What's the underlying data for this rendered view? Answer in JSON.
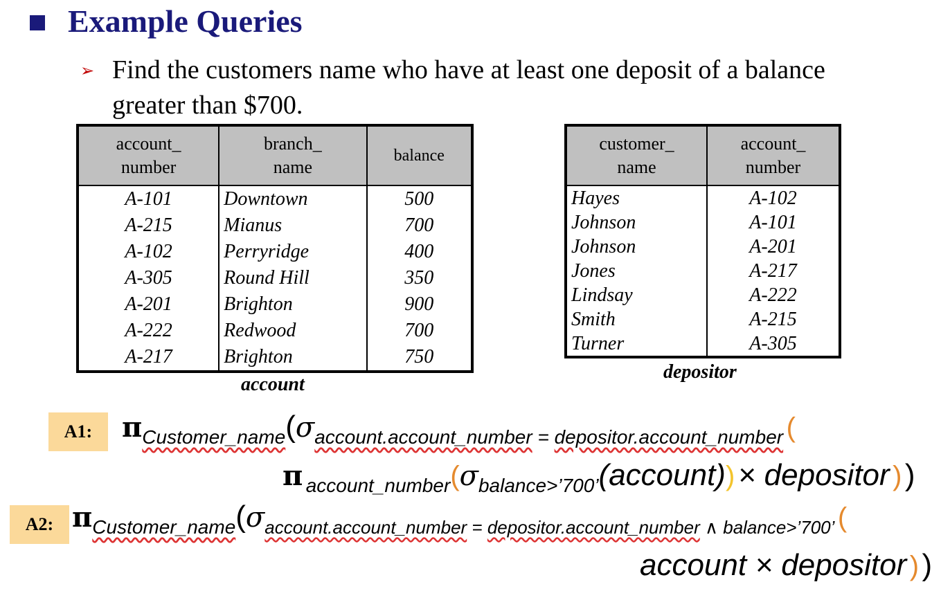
{
  "heading": "Example Queries",
  "task_line1": "Find the customers name who have at least one deposit of a balance",
  "task_line2": "greater than  $700.",
  "account": {
    "caption": "account",
    "headers": [
      [
        "account_",
        "number"
      ],
      [
        "branch_",
        "name"
      ],
      [
        "balance",
        ""
      ]
    ],
    "rows": [
      [
        "A-101",
        "Downtown",
        "500"
      ],
      [
        "A-215",
        "Mianus",
        "700"
      ],
      [
        "A-102",
        "Perryridge",
        "400"
      ],
      [
        "A-305",
        "Round Hill",
        "350"
      ],
      [
        "A-201",
        "Brighton",
        "900"
      ],
      [
        "A-222",
        "Redwood",
        "700"
      ],
      [
        "A-217",
        "Brighton",
        "750"
      ]
    ]
  },
  "depositor": {
    "caption": "depositor",
    "headers": [
      [
        "customer_",
        "name"
      ],
      [
        "account_",
        "number"
      ]
    ],
    "rows": [
      [
        "Hayes",
        "A-102"
      ],
      [
        "Johnson",
        "A-101"
      ],
      [
        "Johnson",
        "A-201"
      ],
      [
        "Jones",
        "A-217"
      ],
      [
        "Lindsay",
        "A-222"
      ],
      [
        "Smith",
        "A-215"
      ],
      [
        "Turner",
        "A-305"
      ]
    ]
  },
  "a1": {
    "label": "A1:",
    "pi": "π",
    "proj": "Customer_name",
    "sigma": "σ",
    "sel_lhs": "account.account_number",
    "eq": " = ",
    "sel_rhs": "depositor.account_number",
    "open": "(",
    "pi2": "π",
    "proj2": "account_number",
    "sigma2": "σ",
    "sel2": "balance>’700’",
    "rel": "(account)",
    "close1": ")",
    "times": "× depositor",
    "close2": ")",
    "close3": ")"
  },
  "a2": {
    "label": "A2:",
    "pi": "π",
    "proj": "Customer_name",
    "sigma": "σ",
    "sel_lhs": "account.account_number",
    "eq": " = ",
    "sel_rhs": "depositor.account_number",
    "and": " ∧ balance>’700’",
    "open": "(",
    "product": "account  × depositor",
    "close1": ")",
    "close2": ")"
  }
}
